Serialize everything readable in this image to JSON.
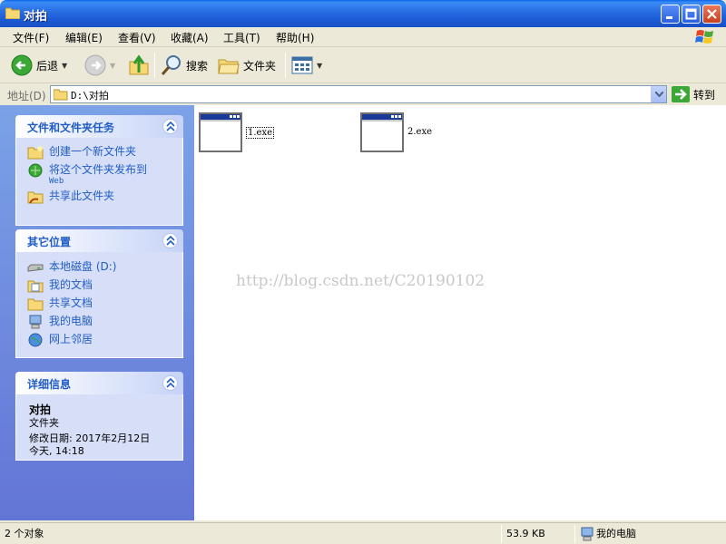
{
  "window": {
    "title": "对拍"
  },
  "menu": [
    "文件(F)",
    "编辑(E)",
    "查看(V)",
    "收藏(A)",
    "工具(T)",
    "帮助(H)"
  ],
  "toolbar": {
    "back_label": "后退",
    "search_label": "搜索",
    "folders_label": "文件夹"
  },
  "address": {
    "label": "地址(D)",
    "path": "D:\\对拍",
    "go_label": "转到"
  },
  "task_panels": {
    "file_tasks": {
      "title": "文件和文件夹任务",
      "items": [
        {
          "label": "创建一个新文件夹",
          "icon": "new-folder-icon"
        },
        {
          "label": "将这个文件夹发布到",
          "sub": "Web",
          "icon": "publish-web-icon"
        },
        {
          "label": "共享此文件夹",
          "icon": "share-folder-icon"
        }
      ]
    },
    "other_places": {
      "title": "其它位置",
      "items": [
        {
          "label": "本地磁盘 (D:)",
          "icon": "local-disk-icon"
        },
        {
          "label": "我的文档",
          "icon": "my-documents-icon"
        },
        {
          "label": "共享文档",
          "icon": "shared-documents-icon"
        },
        {
          "label": "我的电脑",
          "icon": "my-computer-icon"
        },
        {
          "label": "网上邻居",
          "icon": "network-places-icon"
        }
      ]
    },
    "details": {
      "title": "详细信息",
      "name": "对拍",
      "type": "文件夹",
      "modified": "修改日期: 2017年2月12日",
      "time": "今天, 14:18"
    }
  },
  "files": [
    {
      "name": "1.exe",
      "selected": true
    },
    {
      "name": "2.exe",
      "selected": false
    }
  ],
  "watermark": "http://blog.csdn.net/C20190102",
  "status": {
    "objects": "2 个对象",
    "size": "53.9 KB",
    "location": "我的电脑"
  },
  "colors": {
    "titlebar": "#2a6fe4",
    "task_link": "#215dc6",
    "pane_gradient_top": "#7ba2e7",
    "pane_gradient_bottom": "#6375d6"
  }
}
